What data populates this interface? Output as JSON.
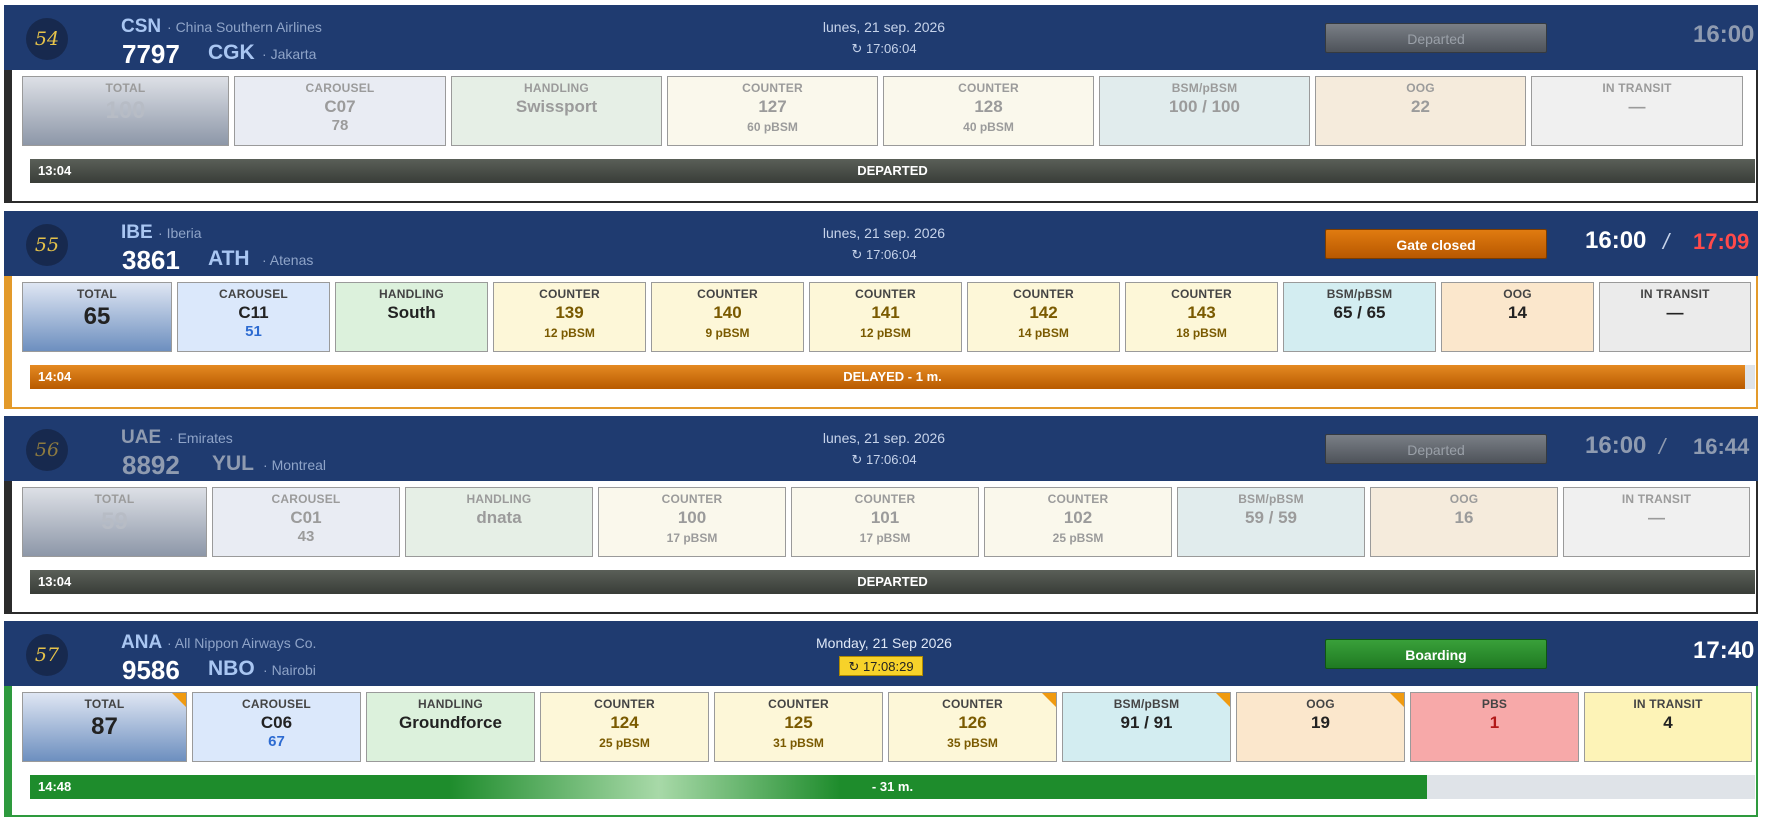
{
  "flights": [
    {
      "seq": "54",
      "airline_code": "CSN",
      "airline_name": "China Southern Airlines",
      "flight_no": "7797",
      "dest_code": "CGK",
      "dest_city": "Jakarta",
      "date": "lunes, 21 sep. 2026",
      "clock": "↻ 17:06:04",
      "status": "Departed",
      "sched_time": "16:00",
      "actual_time": "",
      "tiles": [
        {
          "label": "TOTAL",
          "value": "100",
          "sub": ""
        },
        {
          "label": "CAROUSEL",
          "value": "C07",
          "sub": "78"
        },
        {
          "label": "HANDLING",
          "value": "Swissport",
          "sub": ""
        },
        {
          "label": "COUNTER",
          "value": "127",
          "sub": "60 pBSM"
        },
        {
          "label": "COUNTER",
          "value": "128",
          "sub": "40 pBSM"
        },
        {
          "label": "BSM/pBSM",
          "value": "100 / 100",
          "sub": ""
        },
        {
          "label": "OOG",
          "value": "22",
          "sub": ""
        },
        {
          "label": "IN TRANSIT",
          "value": "—",
          "sub": ""
        }
      ],
      "bar_time": "13:04",
      "bar_label": "DEPARTED",
      "progress_pct": 100
    },
    {
      "seq": "55",
      "airline_code": "IBE",
      "airline_name": "Iberia",
      "flight_no": "3861",
      "dest_code": "ATH",
      "dest_city": "Atenas",
      "date": "lunes, 21 sep. 2026",
      "clock": "↻ 17:06:04",
      "status": "Gate closed",
      "sched_time": "16:00",
      "actual_time": "17:09",
      "tiles": [
        {
          "label": "TOTAL",
          "value": "65",
          "sub": ""
        },
        {
          "label": "CAROUSEL",
          "value": "C11",
          "sub": "51"
        },
        {
          "label": "HANDLING",
          "value": "South",
          "sub": ""
        },
        {
          "label": "COUNTER",
          "value": "139",
          "sub": "12 pBSM"
        },
        {
          "label": "COUNTER",
          "value": "140",
          "sub": "9 pBSM"
        },
        {
          "label": "COUNTER",
          "value": "141",
          "sub": "12 pBSM"
        },
        {
          "label": "COUNTER",
          "value": "142",
          "sub": "14 pBSM"
        },
        {
          "label": "COUNTER",
          "value": "143",
          "sub": "18 pBSM"
        },
        {
          "label": "BSM/pBSM",
          "value": "65 / 65",
          "sub": ""
        },
        {
          "label": "OOG",
          "value": "14",
          "sub": ""
        },
        {
          "label": "IN TRANSIT",
          "value": "—",
          "sub": ""
        }
      ],
      "bar_time": "14:04",
      "bar_label": "DELAYED - 1 m.",
      "progress_pct": 99
    },
    {
      "seq": "56",
      "airline_code": "UAE",
      "airline_name": "Emirates",
      "flight_no": "8892",
      "dest_code": "YUL",
      "dest_city": "Montreal",
      "date": "lunes, 21 sep. 2026",
      "clock": "↻ 17:06:04",
      "status": "Departed",
      "sched_time": "16:00",
      "actual_time": "16:44",
      "tiles": [
        {
          "label": "TOTAL",
          "value": "59",
          "sub": ""
        },
        {
          "label": "CAROUSEL",
          "value": "C01",
          "sub": "43"
        },
        {
          "label": "HANDLING",
          "value": "dnata",
          "sub": ""
        },
        {
          "label": "COUNTER",
          "value": "100",
          "sub": "17 pBSM"
        },
        {
          "label": "COUNTER",
          "value": "101",
          "sub": "17 pBSM"
        },
        {
          "label": "COUNTER",
          "value": "102",
          "sub": "25 pBSM"
        },
        {
          "label": "BSM/pBSM",
          "value": "59 / 59",
          "sub": ""
        },
        {
          "label": "OOG",
          "value": "16",
          "sub": ""
        },
        {
          "label": "IN TRANSIT",
          "value": "—",
          "sub": ""
        }
      ],
      "bar_time": "13:04",
      "bar_label": "DEPARTED",
      "progress_pct": 100
    },
    {
      "seq": "57",
      "airline_code": "ANA",
      "airline_name": "All Nippon Airways Co.",
      "flight_no": "9586",
      "dest_code": "NBO",
      "dest_city": "Nairobi",
      "date": "Monday, 21 Sep 2026",
      "clock": "↻ 17:08:29",
      "status": "Boarding",
      "sched_time": "17:40",
      "actual_time": "",
      "tiles": [
        {
          "label": "TOTAL",
          "value": "87",
          "sub": ""
        },
        {
          "label": "CAROUSEL",
          "value": "C06",
          "sub": "67"
        },
        {
          "label": "HANDLING",
          "value": "Groundforce",
          "sub": ""
        },
        {
          "label": "COUNTER",
          "value": "124",
          "sub": "25 pBSM"
        },
        {
          "label": "COUNTER",
          "value": "125",
          "sub": "31 pBSM"
        },
        {
          "label": "COUNTER",
          "value": "126",
          "sub": "35 pBSM"
        },
        {
          "label": "BSM/pBSM",
          "value": "91 / 91",
          "sub": ""
        },
        {
          "label": "OOG",
          "value": "19",
          "sub": ""
        },
        {
          "label": "PBS",
          "value": "1",
          "sub": ""
        },
        {
          "label": "IN TRANSIT",
          "value": "4",
          "sub": ""
        }
      ],
      "bar_time": "14:48",
      "bar_label": "- 31 m.",
      "progress_pct": 81
    }
  ],
  "colors": {
    "header": "#1f3b70",
    "departed": "#4e535a",
    "gate_closed": "#e07b10",
    "boarding": "#1f7a22",
    "delay_red": "#ff4a4a"
  }
}
